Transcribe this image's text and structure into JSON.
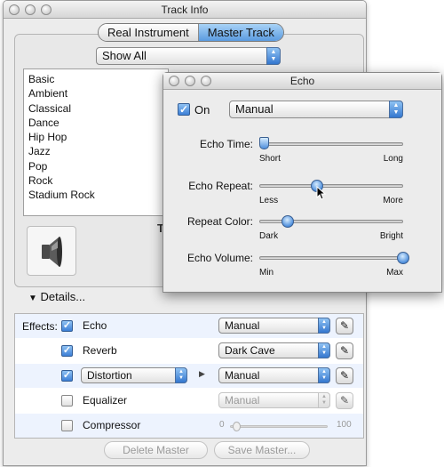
{
  "track_info": {
    "title": "Track Info",
    "tabs": [
      "Real Instrument",
      "Master Track"
    ],
    "active_tab": "Master Track",
    "filter": "Show All",
    "list_items": [
      "Basic",
      "Ambient",
      "Classical",
      "Dance",
      "Hip Hop",
      "Jazz",
      "Pop",
      "Rock",
      "Stadium Rock"
    ],
    "partial_label": "Te",
    "details_label": "Details...",
    "effects_label": "Effects:",
    "effects": [
      {
        "name": "Echo",
        "checked": true,
        "preset": "Manual"
      },
      {
        "name": "Reverb",
        "checked": true,
        "preset": "Dark Cave"
      },
      {
        "name": "Distortion",
        "checked": true,
        "type": "Distortion",
        "preset": "Manual"
      },
      {
        "name": "Equalizer",
        "checked": false,
        "preset": "Manual"
      },
      {
        "name": "Compressor",
        "checked": false,
        "min": "0",
        "max": "100",
        "value": 0
      }
    ],
    "buttons": {
      "delete": "Delete Master",
      "save": "Save Master..."
    }
  },
  "echo": {
    "title": "Echo",
    "on_label": "On",
    "on_checked": true,
    "preset": "Manual",
    "sliders": [
      {
        "label": "Echo Time:",
        "min_label": "Short",
        "max_label": "Long",
        "value": 0.03
      },
      {
        "label": "Echo Repeat:",
        "min_label": "Less",
        "max_label": "More",
        "value": 0.4
      },
      {
        "label": "Repeat Color:",
        "min_label": "Dark",
        "max_label": "Bright",
        "value": 0.2
      },
      {
        "label": "Echo Volume:",
        "min_label": "Min",
        "max_label": "Max",
        "value": 1.0
      }
    ]
  }
}
